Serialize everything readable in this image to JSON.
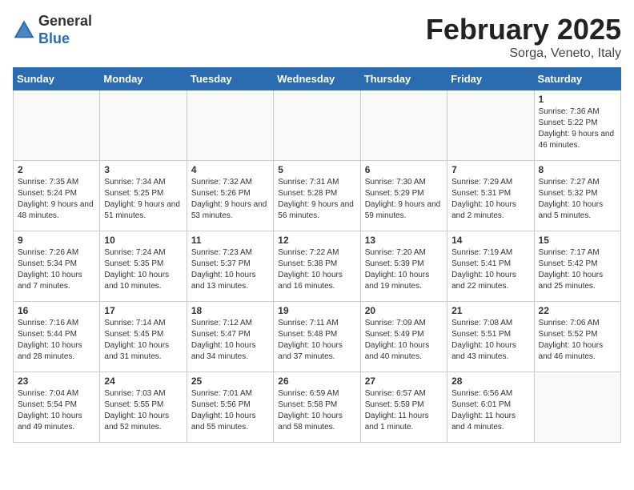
{
  "header": {
    "logo_line1": "General",
    "logo_line2": "Blue",
    "title": "February 2025",
    "subtitle": "Sorga, Veneto, Italy"
  },
  "days_of_week": [
    "Sunday",
    "Monday",
    "Tuesday",
    "Wednesday",
    "Thursday",
    "Friday",
    "Saturday"
  ],
  "weeks": [
    [
      {
        "num": "",
        "info": "",
        "empty": true
      },
      {
        "num": "",
        "info": "",
        "empty": true
      },
      {
        "num": "",
        "info": "",
        "empty": true
      },
      {
        "num": "",
        "info": "",
        "empty": true
      },
      {
        "num": "",
        "info": "",
        "empty": true
      },
      {
        "num": "",
        "info": "",
        "empty": true
      },
      {
        "num": "1",
        "info": "Sunrise: 7:36 AM\nSunset: 5:22 PM\nDaylight: 9 hours and 46 minutes."
      }
    ],
    [
      {
        "num": "2",
        "info": "Sunrise: 7:35 AM\nSunset: 5:24 PM\nDaylight: 9 hours and 48 minutes."
      },
      {
        "num": "3",
        "info": "Sunrise: 7:34 AM\nSunset: 5:25 PM\nDaylight: 9 hours and 51 minutes."
      },
      {
        "num": "4",
        "info": "Sunrise: 7:32 AM\nSunset: 5:26 PM\nDaylight: 9 hours and 53 minutes."
      },
      {
        "num": "5",
        "info": "Sunrise: 7:31 AM\nSunset: 5:28 PM\nDaylight: 9 hours and 56 minutes."
      },
      {
        "num": "6",
        "info": "Sunrise: 7:30 AM\nSunset: 5:29 PM\nDaylight: 9 hours and 59 minutes."
      },
      {
        "num": "7",
        "info": "Sunrise: 7:29 AM\nSunset: 5:31 PM\nDaylight: 10 hours and 2 minutes."
      },
      {
        "num": "8",
        "info": "Sunrise: 7:27 AM\nSunset: 5:32 PM\nDaylight: 10 hours and 5 minutes."
      }
    ],
    [
      {
        "num": "9",
        "info": "Sunrise: 7:26 AM\nSunset: 5:34 PM\nDaylight: 10 hours and 7 minutes."
      },
      {
        "num": "10",
        "info": "Sunrise: 7:24 AM\nSunset: 5:35 PM\nDaylight: 10 hours and 10 minutes."
      },
      {
        "num": "11",
        "info": "Sunrise: 7:23 AM\nSunset: 5:37 PM\nDaylight: 10 hours and 13 minutes."
      },
      {
        "num": "12",
        "info": "Sunrise: 7:22 AM\nSunset: 5:38 PM\nDaylight: 10 hours and 16 minutes."
      },
      {
        "num": "13",
        "info": "Sunrise: 7:20 AM\nSunset: 5:39 PM\nDaylight: 10 hours and 19 minutes."
      },
      {
        "num": "14",
        "info": "Sunrise: 7:19 AM\nSunset: 5:41 PM\nDaylight: 10 hours and 22 minutes."
      },
      {
        "num": "15",
        "info": "Sunrise: 7:17 AM\nSunset: 5:42 PM\nDaylight: 10 hours and 25 minutes."
      }
    ],
    [
      {
        "num": "16",
        "info": "Sunrise: 7:16 AM\nSunset: 5:44 PM\nDaylight: 10 hours and 28 minutes."
      },
      {
        "num": "17",
        "info": "Sunrise: 7:14 AM\nSunset: 5:45 PM\nDaylight: 10 hours and 31 minutes."
      },
      {
        "num": "18",
        "info": "Sunrise: 7:12 AM\nSunset: 5:47 PM\nDaylight: 10 hours and 34 minutes."
      },
      {
        "num": "19",
        "info": "Sunrise: 7:11 AM\nSunset: 5:48 PM\nDaylight: 10 hours and 37 minutes."
      },
      {
        "num": "20",
        "info": "Sunrise: 7:09 AM\nSunset: 5:49 PM\nDaylight: 10 hours and 40 minutes."
      },
      {
        "num": "21",
        "info": "Sunrise: 7:08 AM\nSunset: 5:51 PM\nDaylight: 10 hours and 43 minutes."
      },
      {
        "num": "22",
        "info": "Sunrise: 7:06 AM\nSunset: 5:52 PM\nDaylight: 10 hours and 46 minutes."
      }
    ],
    [
      {
        "num": "23",
        "info": "Sunrise: 7:04 AM\nSunset: 5:54 PM\nDaylight: 10 hours and 49 minutes."
      },
      {
        "num": "24",
        "info": "Sunrise: 7:03 AM\nSunset: 5:55 PM\nDaylight: 10 hours and 52 minutes."
      },
      {
        "num": "25",
        "info": "Sunrise: 7:01 AM\nSunset: 5:56 PM\nDaylight: 10 hours and 55 minutes."
      },
      {
        "num": "26",
        "info": "Sunrise: 6:59 AM\nSunset: 5:58 PM\nDaylight: 10 hours and 58 minutes."
      },
      {
        "num": "27",
        "info": "Sunrise: 6:57 AM\nSunset: 5:59 PM\nDaylight: 11 hours and 1 minute."
      },
      {
        "num": "28",
        "info": "Sunrise: 6:56 AM\nSunset: 6:01 PM\nDaylight: 11 hours and 4 minutes."
      },
      {
        "num": "",
        "info": "",
        "empty": true
      }
    ]
  ]
}
